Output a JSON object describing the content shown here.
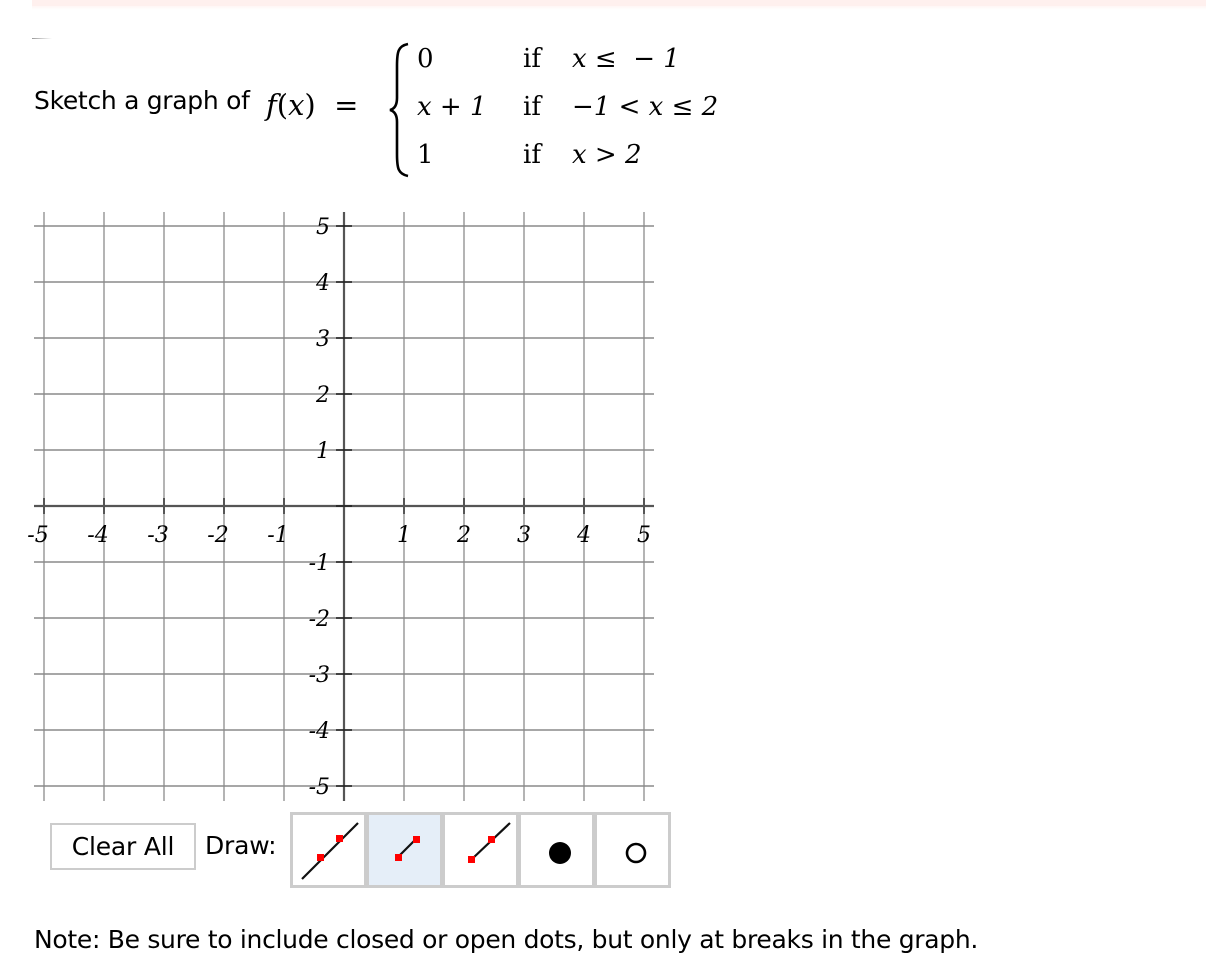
{
  "question": {
    "prompt": "Sketch a graph of",
    "function_lhs": "f(x) =",
    "cases": [
      {
        "expr": "0",
        "cond_word": "if",
        "condition": "x ≤  − 1"
      },
      {
        "expr": "x + 1",
        "cond_word": "if",
        "condition": "−1 < x ≤ 2"
      },
      {
        "expr": "1",
        "cond_word": "if",
        "condition": "x > 2"
      }
    ]
  },
  "graph": {
    "x_range": [
      -5,
      5
    ],
    "y_range": [
      -5,
      5
    ],
    "x_ticks": [
      "-5",
      "-4",
      "-3",
      "-2",
      "-1",
      "1",
      "2",
      "3",
      "4",
      "5"
    ],
    "y_ticks": [
      "5",
      "4",
      "3",
      "2",
      "1",
      "-1",
      "-2",
      "-3",
      "-4",
      "-5"
    ],
    "grid": true,
    "colors": {
      "grid": "#b4b4b4",
      "axis": "#555555",
      "point": "#ff0000"
    }
  },
  "toolbar": {
    "clear_label": "Clear All",
    "draw_label": "Draw:",
    "tools": [
      {
        "name": "line",
        "icon": "line-tool-icon",
        "selected": false
      },
      {
        "name": "segment",
        "icon": "segment-tool-icon",
        "selected": true
      },
      {
        "name": "ray",
        "icon": "ray-tool-icon",
        "selected": false
      },
      {
        "name": "closed-dot",
        "icon": "closed-dot-icon",
        "selected": false
      },
      {
        "name": "open-dot",
        "icon": "open-dot-icon",
        "selected": false
      }
    ]
  },
  "note": "Note: Be sure to include closed or open dots, but only at breaks in the graph."
}
